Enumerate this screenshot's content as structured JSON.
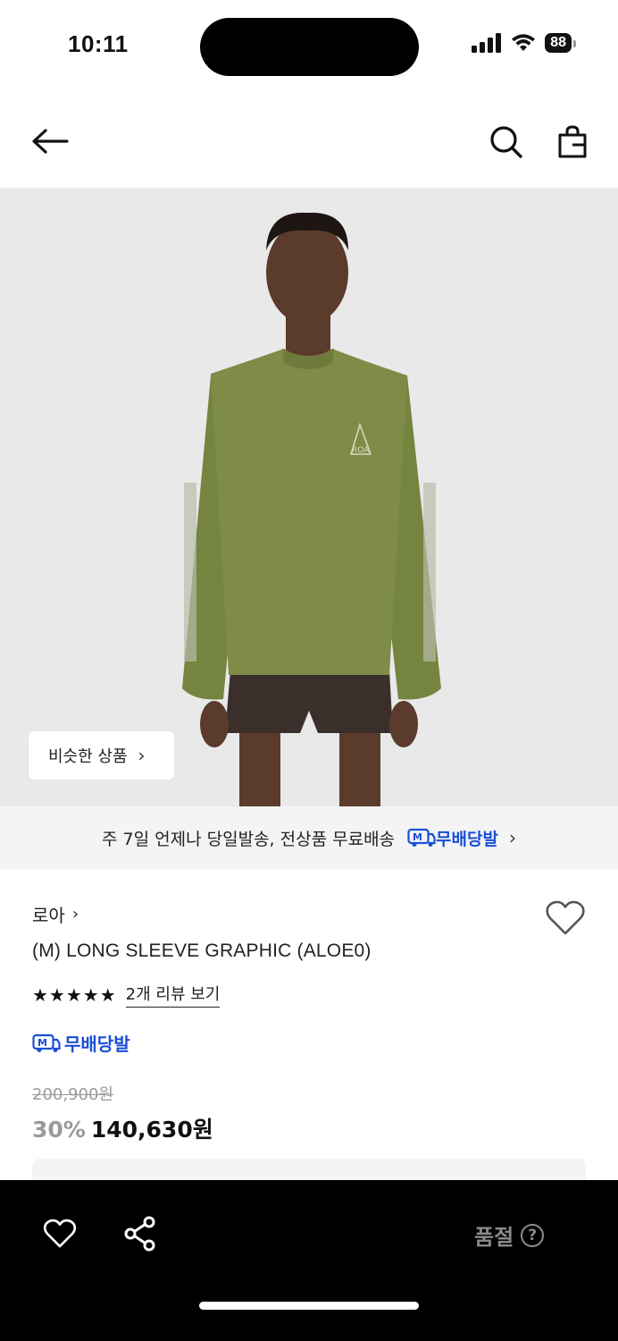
{
  "status_bar": {
    "time": "10:11",
    "battery": "88"
  },
  "nav": {
    "back_icon": "arrow-left-icon",
    "search_icon": "search-icon",
    "bag_icon": "shopping-bag-icon"
  },
  "hero": {
    "similar_products_label": "비슷한 상품",
    "similar_chevron": "›",
    "colors": {
      "background": "#e9e9ea",
      "sweater": "#7f8c47",
      "shorts": "#3b2f2c",
      "skin": "#5a3b2c"
    }
  },
  "delivery_banner": {
    "text": "주 7일 언제나 당일발송, 전상품 무료배송",
    "badge_label": "무배당발",
    "chevron": "›"
  },
  "product": {
    "brand": "로아",
    "brand_chevron": "›",
    "name": "(M) LONG SLEEVE GRAPHIC (ALOE0)",
    "stars": "★★★★★",
    "rating_stars": 5,
    "review_link": "2개 리뷰 보기",
    "free_shipping_badge": "무배당발",
    "original_price": "200,900원",
    "discount": "30%",
    "sale_price": "140,630원"
  },
  "bottom_bar": {
    "heart_icon": "heart-icon",
    "share_icon": "share-icon",
    "soldout_label": "품절",
    "help_glyph": "?"
  },
  "colors": {
    "accent_blue": "#1a4fd6",
    "muted_gray": "#9a9a9a"
  }
}
